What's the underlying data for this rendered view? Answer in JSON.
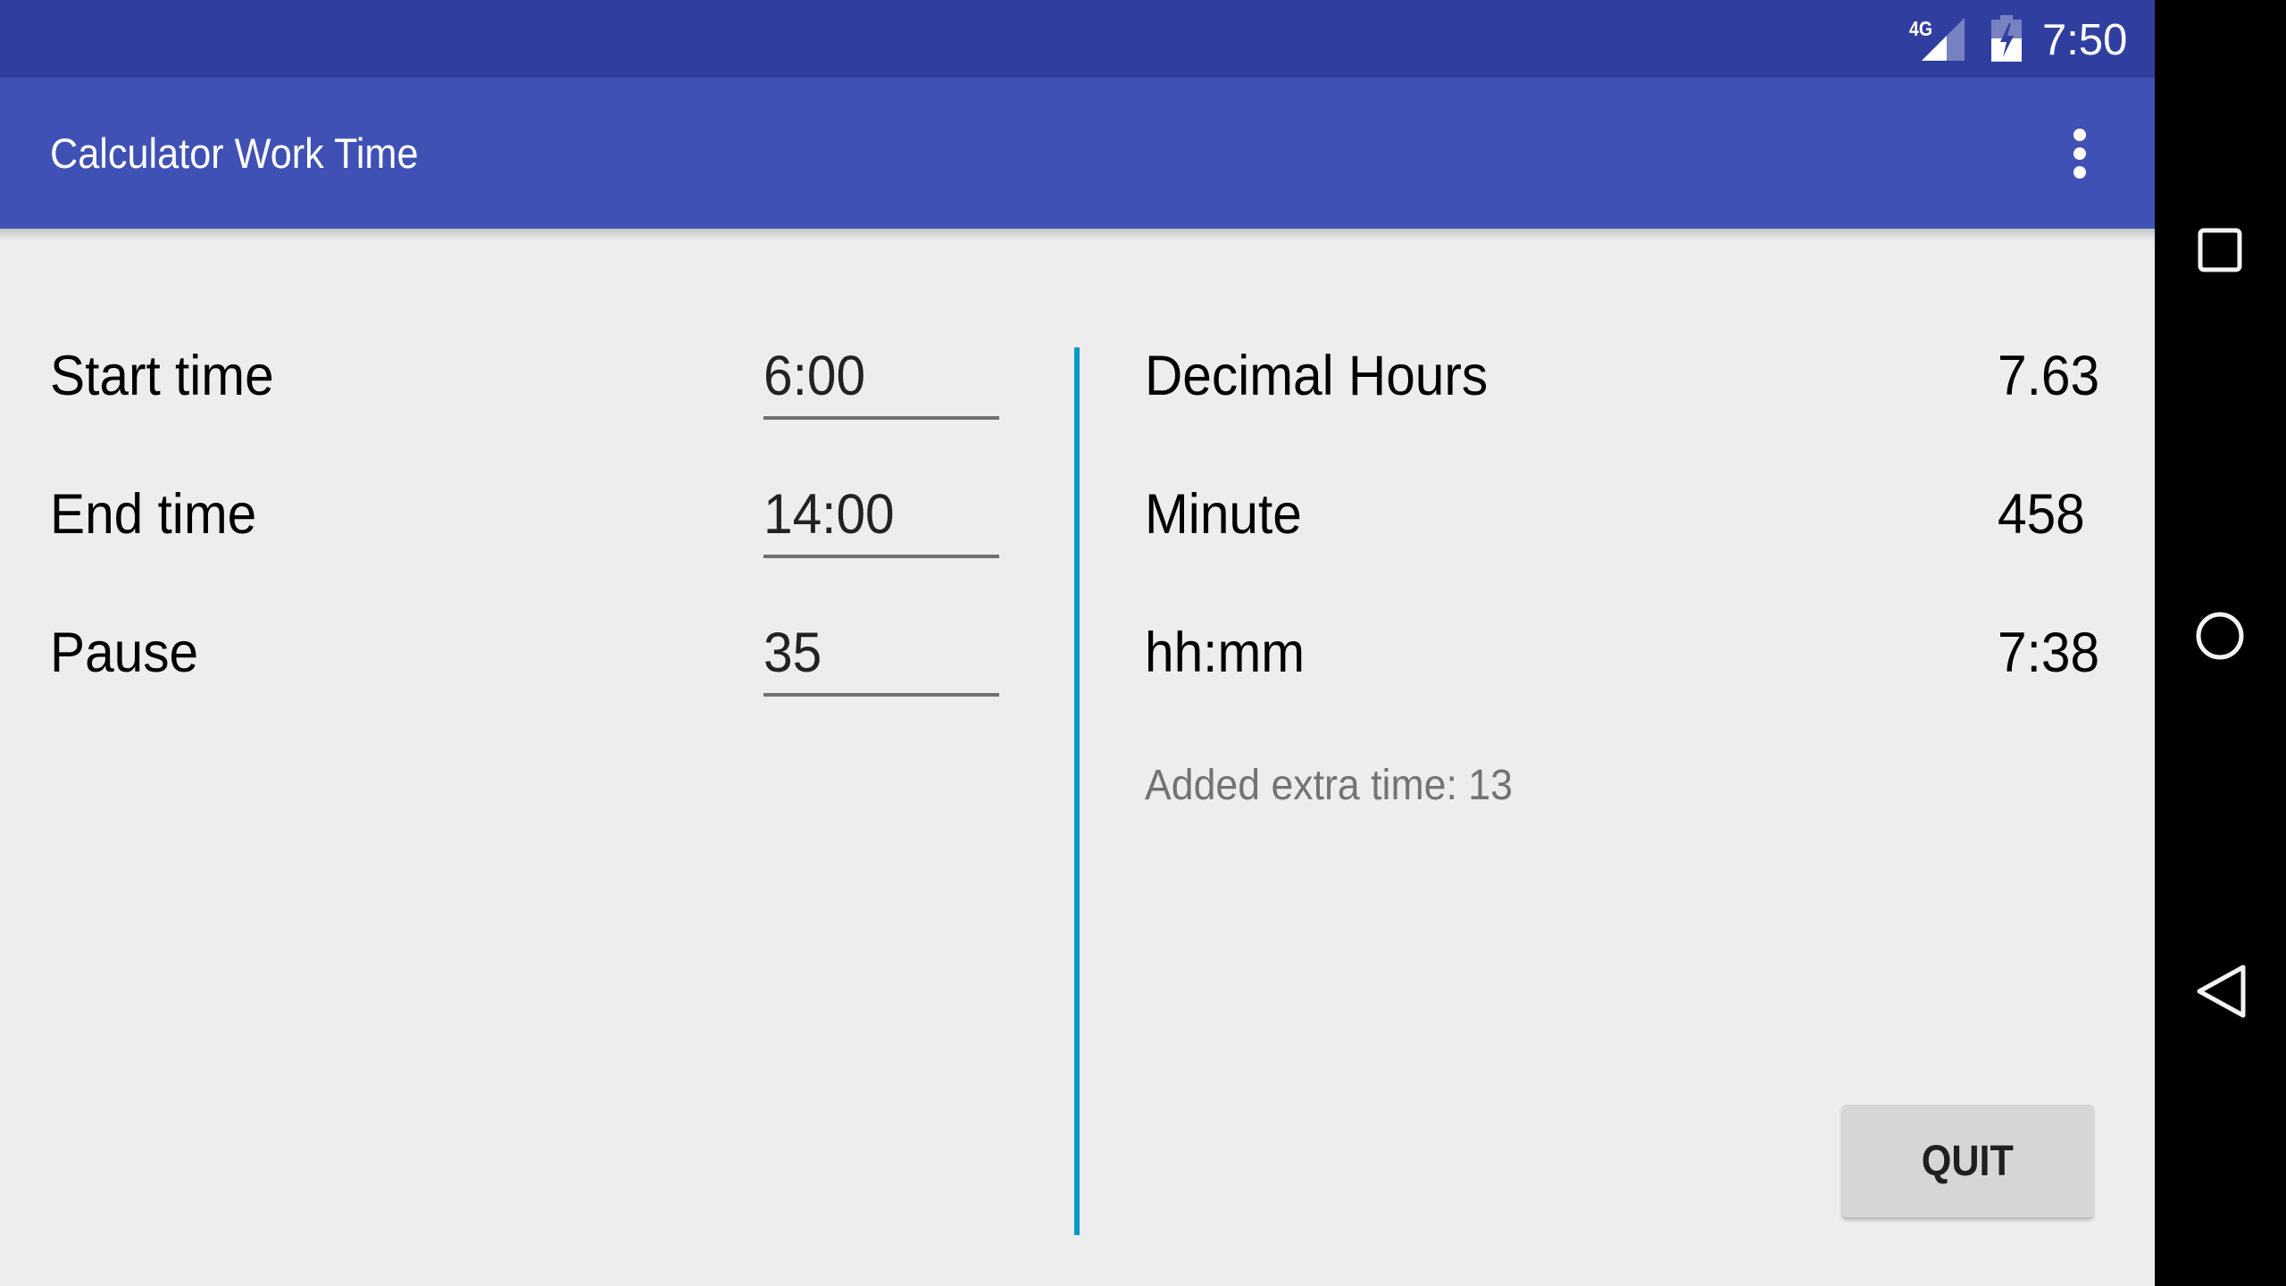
{
  "status_bar": {
    "network_label": "4G",
    "time": "7:50",
    "icons": [
      "signal-icon",
      "battery-charging-icon"
    ]
  },
  "toolbar": {
    "title": "Calculator Work Time",
    "overflow_icon": "more-vert-icon"
  },
  "inputs": [
    {
      "label": "Start time",
      "value": "6:00"
    },
    {
      "label": "End time",
      "value": "14:00"
    },
    {
      "label": "Pause",
      "value": "35"
    }
  ],
  "results": [
    {
      "label": "Decimal Hours",
      "value": "7.63"
    },
    {
      "label": "Minute",
      "value": "458"
    },
    {
      "label": "hh:mm",
      "value": "7:38"
    }
  ],
  "extra_time_text": "Added extra time: 13",
  "quit_label": "QUIT",
  "nav_bar": {
    "icons": [
      "recents-icon",
      "home-icon",
      "back-icon"
    ]
  },
  "colors": {
    "status_bar": "#303F9F",
    "toolbar": "#3F51B5",
    "accent_divider": "#0099CC",
    "background": "#EEEDEE"
  }
}
